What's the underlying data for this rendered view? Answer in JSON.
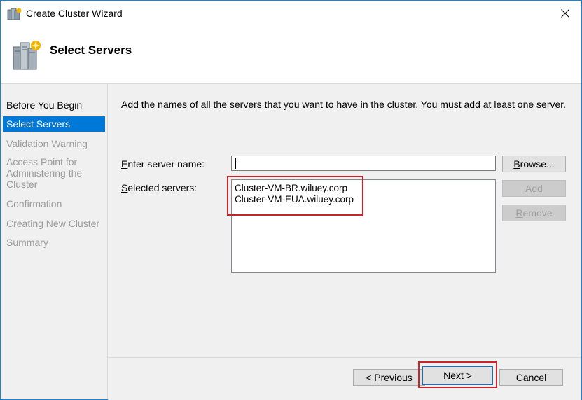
{
  "window": {
    "title": "Create Cluster Wizard",
    "icon": "cluster-wizard-icon",
    "close_glyph": "✕"
  },
  "header": {
    "title": "Select Servers",
    "icon": "servers-icon"
  },
  "nav": {
    "items": [
      {
        "label": "Before You Begin",
        "state": "done"
      },
      {
        "label": "Select Servers",
        "state": "active"
      },
      {
        "label": "Validation Warning",
        "state": "pending"
      },
      {
        "label_lines": [
          "Access Point for",
          "Administering the",
          "Cluster"
        ],
        "state": "pending"
      },
      {
        "label": "Confirmation",
        "state": "pending"
      },
      {
        "label": "Creating New Cluster",
        "state": "pending"
      },
      {
        "label": "Summary",
        "state": "pending"
      }
    ]
  },
  "main": {
    "instructions": "Add the names of all the servers that you want to have in the cluster. You must add at least one server.",
    "server_name_label_mnemonic": "E",
    "server_name_label_rest": "nter server name:",
    "server_name_value": "",
    "selected_label_mnemonic": "S",
    "selected_label_rest": "elected servers:",
    "selected_servers": [
      "Cluster-VM-BR.wiluey.corp",
      "Cluster-VM-EUA.wiluey.corp"
    ],
    "browse": {
      "mnemonic": "B",
      "rest": "rowse..."
    },
    "add": {
      "mnemonic": "A",
      "rest": "dd",
      "enabled": false
    },
    "remove": {
      "mnemonic": "R",
      "rest": "emove",
      "enabled": false
    }
  },
  "footer": {
    "previous": {
      "prefix": "< ",
      "mnemonic": "P",
      "rest": "revious"
    },
    "next": {
      "mnemonic": "N",
      "rest": "ext >"
    },
    "cancel": "Cancel"
  },
  "colors": {
    "accent": "#0078d7",
    "annotation": "#c8242c",
    "panel": "#f0f0f0"
  }
}
